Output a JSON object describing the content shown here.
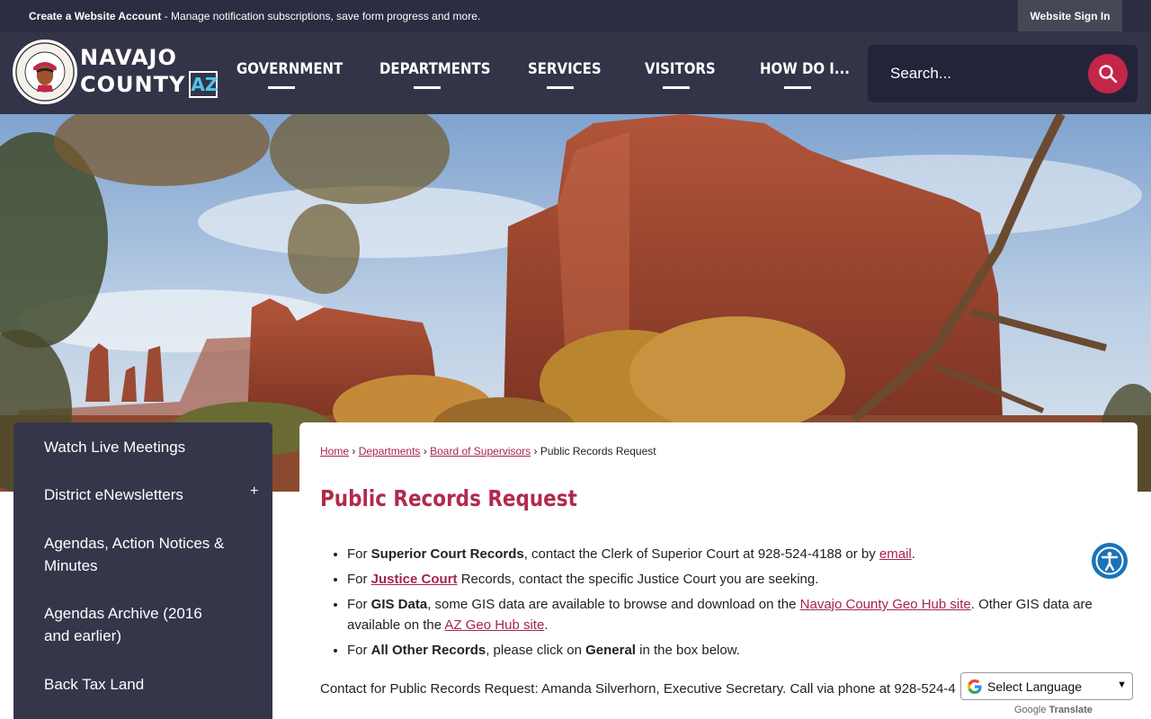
{
  "topbar": {
    "create_bold": "Create a Website Account",
    "create_rest": " - Manage notification subscriptions, save form progress and more.",
    "signin": "Website Sign In"
  },
  "logo": {
    "line1": "NAVAJO",
    "line2": "COUNTY",
    "az": "AZ"
  },
  "nav": {
    "items": [
      "GOVERNMENT",
      "DEPARTMENTS",
      "SERVICES",
      "VISITORS",
      "HOW DO I..."
    ]
  },
  "search": {
    "placeholder": "Search..."
  },
  "sidebar": {
    "items": [
      "Watch Live Meetings",
      "District eNewsletters",
      "Agendas, Action Notices & Minutes",
      "Agendas Archive (2016 and earlier)",
      "Back Tax Land"
    ],
    "expand_symbol": "+"
  },
  "breadcrumb": {
    "home": "Home",
    "departments": "Departments",
    "board": "Board of Supervisors",
    "current": "Public Records Request",
    "separator": "›"
  },
  "page": {
    "title": "Public Records Request",
    "b1_pre": "For ",
    "b1_bold": "Superior Court Records",
    "b1_mid": ", contact the Clerk of Superior Court at 928-524-4188 or by ",
    "b1_link": "email",
    "b1_end": ".",
    "b2_pre": "For ",
    "b2_link": "Justice Court",
    "b2_end": " Records, contact the specific Justice Court you are seeking.",
    "b3_pre": "For ",
    "b3_bold": "GIS Data",
    "b3_mid": ", some GIS data are available to browse and download on the ",
    "b3_link1": "Navajo County Geo Hub site",
    "b3_mid2": ". Other GIS data are available on the ",
    "b3_link2": "AZ Geo Hub site",
    "b3_end": ".",
    "b4_pre": "For ",
    "b4_bold": "All Other Records",
    "b4_mid": ", please click on ",
    "b4_bold2": "General",
    "b4_end": " in the box below.",
    "contact": "Contact for Public Records Request: Amanda Silverhorn, Executive Secretary. Call via phone at 928-524-4"
  },
  "translate": {
    "label": "Select Language",
    "powered_google": "Google",
    "powered_translate": "Translate"
  },
  "colors": {
    "topbar": "#2c2d42",
    "header": "#333447",
    "accent": "#b2294d",
    "search_button": "#c4264a",
    "sidebar": "#35364a"
  }
}
